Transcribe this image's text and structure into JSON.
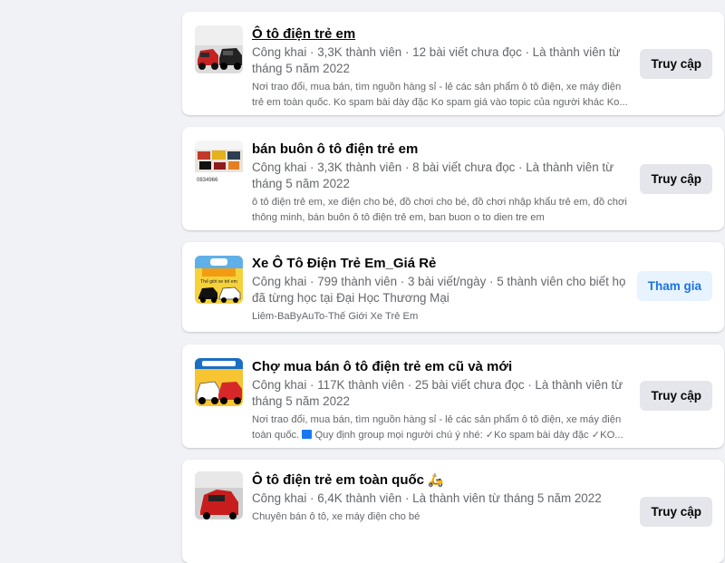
{
  "groups": [
    {
      "title": "Ô tô điện trẻ em",
      "meta": "Công khai · 3,3K thành viên · 12 bài viết chưa đọc · Là thành viên từ tháng 5 năm 2022",
      "desc": "Nơi trao đổi, mua bán, tìm nguồn hàng sỉ - lẻ các sản phẩm ô tô điện, xe máy điện trẻ em toàn quốc. Ko spam bài dày đặc Ko spam giá vào topic của người khác Ko...",
      "button": "Truy cập"
    },
    {
      "title": "bán buôn ô tô điện trẻ em",
      "meta": "Công khai · 3,3K thành viên · 8 bài viết chưa đọc · Là thành viên từ tháng 5 năm 2022",
      "desc": "ô tô điện trẻ em, xe điện cho bé, đồ chơi cho bé, đồ chơi nhập khẩu trẻ em, đồ chơi thông minh, bán buôn ô tô điện trẻ em, ban buon o to dien tre em",
      "thumb_text": "0834966",
      "button": "Truy cập"
    },
    {
      "title": "Xe Ô Tô Điện Trẻ Em_Giá Rẻ",
      "meta": "Công khai · 799 thành viên · 3 bài viết/ngày · 5 thành viên cho biết họ đã từng học tại Đại Học Thương Mại",
      "desc": "Liêm-BaByAuTo-Thế Giới Xe Trẻ Em",
      "thumb_text": "Thế giới xe trẻ em",
      "button": "Tham gia"
    },
    {
      "title": "Chợ mua bán ô tô điện trẻ em cũ và mới",
      "meta": "Công khai · 117K thành viên · 25 bài viết chưa đọc · Là thành viên từ tháng 5 năm 2022",
      "desc_a": "Nơi trao đổi, mua bán, tìm nguồn hàng sỉ - lẻ các sản phẩm ô tô điện, xe máy điện toàn quốc. ",
      "desc_b": " Quy định group mọi người chú ý nhé: ✓Ko spam bài dày đặc ✓KO...",
      "button": "Truy cập"
    },
    {
      "title": "Ô tô điện trẻ em toàn quốc",
      "title_emoji": "🛵",
      "meta": "Công khai · 6,4K thành viên · Là thành viên từ tháng 5 năm 2022",
      "desc": "Chuyên bán ô tô, xe máy điện cho bé",
      "button": "Truy cập"
    }
  ]
}
